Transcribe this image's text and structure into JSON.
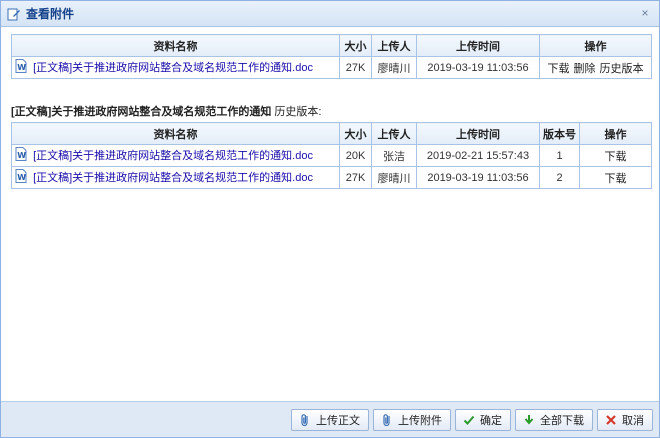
{
  "dialog": {
    "title": "查看附件",
    "close_glyph": "×"
  },
  "current": {
    "headers": [
      "资料名称",
      "大小",
      "上传人",
      "上传时间",
      "操作"
    ],
    "rows": [
      {
        "name": "[正文稿]关于推进政府网站整合及域名规范工作的通知.doc",
        "size": "27K",
        "uploader": "廖晴川",
        "time": "2019-03-19 11:03:56",
        "actions": [
          "下载",
          "删除",
          "历史版本"
        ]
      }
    ]
  },
  "history": {
    "caption_bold": "[正文稿]关于推进政府网站整合及域名规范工作的通知",
    "caption_suffix": "历史版本:",
    "headers": [
      "资料名称",
      "大小",
      "上传人",
      "上传时间",
      "版本号",
      "操作"
    ],
    "rows": [
      {
        "name": "[正文稿]关于推进政府网站整合及域名规范工作的通知.doc",
        "size": "20K",
        "uploader": "张洁",
        "time": "2019-02-21 15:57:43",
        "version": "1",
        "action": "下载"
      },
      {
        "name": "[正文稿]关于推进政府网站整合及域名规范工作的通知.doc",
        "size": "27K",
        "uploader": "廖晴川",
        "time": "2019-03-19 11:03:56",
        "version": "2",
        "action": "下载"
      }
    ]
  },
  "footer": {
    "upload_main": "上传正文",
    "upload_attach": "上传附件",
    "confirm": "确定",
    "download_all": "全部下载",
    "cancel": "取消"
  },
  "icons": {
    "title": "edit-icon",
    "file": "word-doc-icon",
    "upload": "paperclip-icon",
    "confirm": "check-icon",
    "download_all": "download-arrow-icon",
    "cancel": "cross-icon"
  }
}
